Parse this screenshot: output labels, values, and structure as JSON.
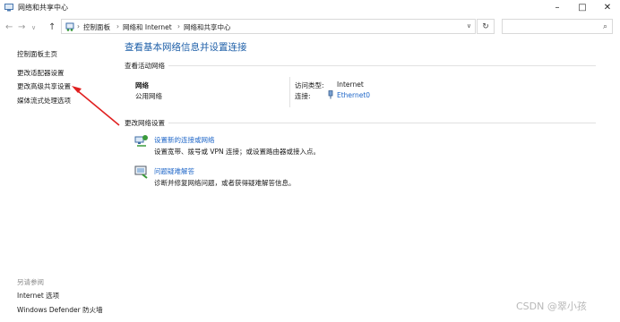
{
  "window": {
    "title": "网络和共享中心"
  },
  "address": {
    "crumbs": [
      "控制面板",
      "网络和 Internet",
      "网络和共享中心"
    ],
    "search_placeholder": ""
  },
  "sidebar": {
    "links": [
      "控制面板主页",
      "更改适配器设置",
      "更改高级共享设置",
      "媒体流式处理选项"
    ],
    "see_also_title": "另请参阅",
    "see_also": [
      "Internet 选项",
      "Windows Defender 防火墙"
    ]
  },
  "main": {
    "title": "查看基本网络信息并设置连接",
    "active_networks_heading": "查看活动网络",
    "network": {
      "name": "网络",
      "type": "公用网络",
      "access_type_label": "访问类型:",
      "access_type_value": "Internet",
      "connections_label": "连接:",
      "connections_value": "Ethernet0"
    },
    "change_settings_heading": "更改网络设置",
    "tasks": [
      {
        "title": "设置新的连接或网络",
        "desc": "设置宽带、拨号或 VPN 连接；或设置路由器或接入点。",
        "icon": "network-setup-icon"
      },
      {
        "title": "问题疑难解答",
        "desc": "诊断并修复网络问题，或者获得疑难解答信息。",
        "icon": "troubleshoot-icon"
      }
    ]
  },
  "watermark": "CSDN @翠小孩",
  "colors": {
    "accent": "#1e5fa8",
    "link": "#1e66c8",
    "annotation": "#e02020"
  }
}
